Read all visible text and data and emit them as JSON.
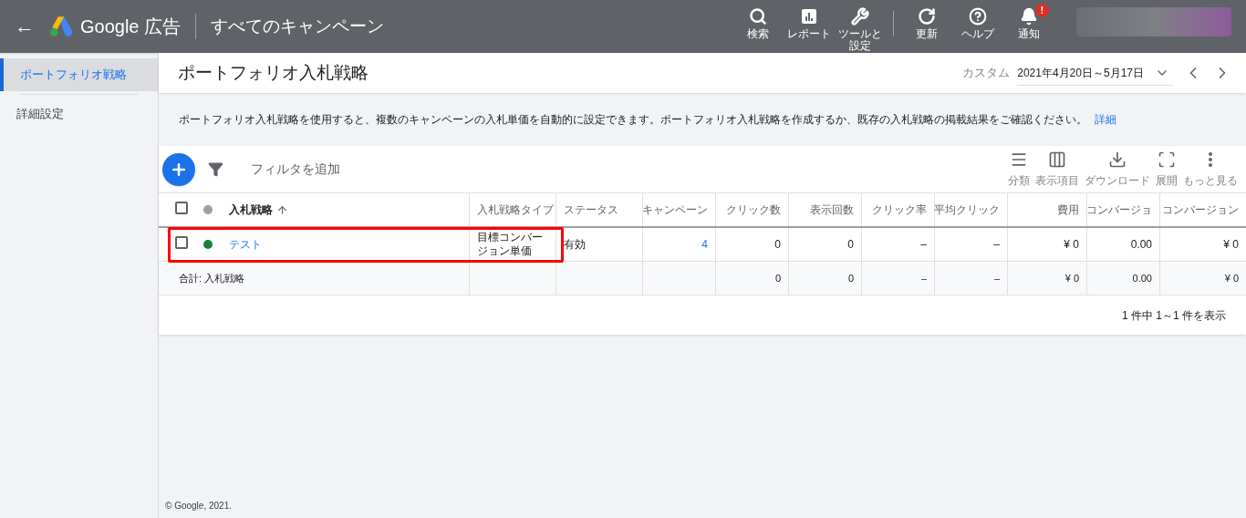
{
  "header": {
    "back": "←",
    "product": "Google 広告",
    "title": "すべてのキャンペーン",
    "actions": [
      {
        "kind": "search",
        "label": "検索"
      },
      {
        "kind": "report",
        "label": "レポート"
      },
      {
        "kind": "tools",
        "label": "ツールと設定"
      },
      {
        "kind": "refresh",
        "label": "更新"
      },
      {
        "kind": "help",
        "label": "ヘルプ"
      },
      {
        "kind": "bell",
        "label": "通知",
        "badge": "!"
      }
    ]
  },
  "sidebar": {
    "items": [
      {
        "label": "ポートフォリオ戦略",
        "selected": true
      },
      {
        "label": "詳細設定",
        "selected": false
      }
    ]
  },
  "page": {
    "title": "ポートフォリオ入札戦略",
    "date_prefix": "カスタム",
    "date_range": "2021年4月20日～5月17日",
    "description": "ポートフォリオ入札戦略を使用すると、複数のキャンペーンの入札単価を自動的に設定できます。ポートフォリオ入札戦略を作成するか、既存の入札戦略の掲載結果をご確認ください。",
    "description_link": "詳細"
  },
  "toolbar": {
    "filter_placeholder": "フィルタを追加",
    "tools": [
      {
        "kind": "segment",
        "label": "分類"
      },
      {
        "kind": "columns",
        "label": "表示項目"
      },
      {
        "kind": "download",
        "label": "ダウンロード"
      },
      {
        "kind": "expand",
        "label": "展開"
      },
      {
        "kind": "more",
        "label": "もっと見る"
      }
    ]
  },
  "table": {
    "columns": [
      "入札戦略",
      "入札戦略タイプ",
      "ステータス",
      "キャンペーン",
      "クリック数",
      "表示回数",
      "クリック率",
      "平均クリック",
      "費用",
      "コンバージョ",
      "コンバージョン"
    ],
    "header_checked": false,
    "rows": [
      {
        "checked": false,
        "highlighted": true,
        "color": "#188038",
        "cells": [
          {
            "text": "テスト",
            "link": true
          },
          {
            "text": "目標コンバージョン単価",
            "link": false
          },
          {
            "text": "有効",
            "link": false
          },
          {
            "text": "4",
            "link": true
          },
          {
            "text": "0",
            "link": false
          },
          {
            "text": "0",
            "link": false
          },
          {
            "text": "–",
            "link": false
          },
          {
            "text": "–",
            "link": false
          },
          {
            "text": "¥ 0",
            "link": false
          },
          {
            "text": "0.00",
            "link": false
          },
          {
            "text": "¥ 0",
            "link": false
          }
        ]
      }
    ],
    "total": {
      "label": "合計: 入札戦略",
      "values": [
        "0",
        "0",
        "–",
        "–",
        "¥ 0",
        "0.00",
        "¥ 0"
      ]
    },
    "pagination": "1 件中 1～1 件を表示"
  },
  "footer": "© Google, 2021."
}
